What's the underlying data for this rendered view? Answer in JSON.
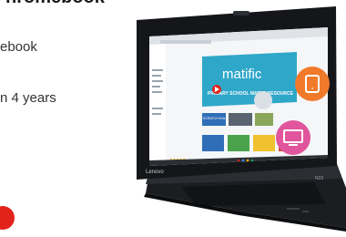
{
  "heading_fragment": "hromebook",
  "copy": {
    "line1": "ebook",
    "line2": "n 4 years"
  },
  "laptop": {
    "bezel_brand": "Lenovo",
    "model_badge": "N23",
    "screen": {
      "banner_title": "matific",
      "banner_subtitle": "PRIMARY SCHOOL MATHS RESOURCE",
      "tile_label": "SCRATCH Kids",
      "rating": "★★★★★"
    }
  },
  "colors": {
    "brand_red": "#e2231a",
    "banner_teal": "#2fa7c9",
    "bubble_orange": "#f07a2a",
    "bubble_pink": "#e0559b"
  },
  "icons": {
    "tablet": "tablet-icon",
    "monitor": "monitor-icon",
    "play": "play-icon"
  }
}
